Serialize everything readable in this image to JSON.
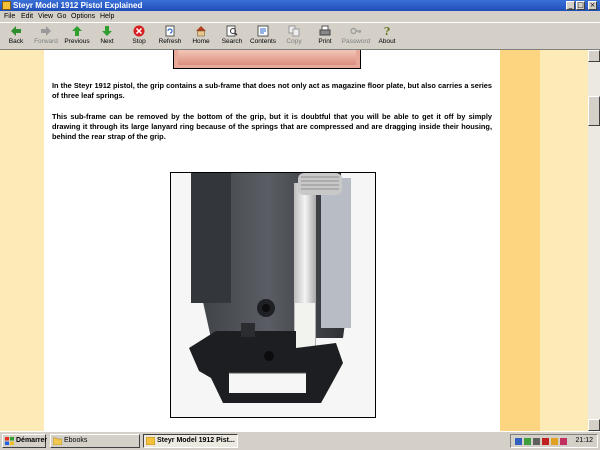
{
  "window": {
    "title": "Steyr Model 1912 Pistol Explained",
    "controls": [
      "_",
      "□",
      "×"
    ]
  },
  "menu": [
    "File",
    "Edit",
    "View",
    "Go",
    "Options",
    "Help"
  ],
  "toolbar": [
    {
      "label": "Back",
      "icon": "back-arrow-icon",
      "enabled": true
    },
    {
      "label": "Forward",
      "icon": "forward-arrow-icon",
      "enabled": false
    },
    {
      "label": "Previous",
      "icon": "previous-arrow-icon",
      "enabled": true
    },
    {
      "label": "Next",
      "icon": "next-arrow-icon",
      "enabled": true
    },
    {
      "label": "Stop",
      "icon": "stop-icon",
      "enabled": true
    },
    {
      "label": "Refresh",
      "icon": "refresh-icon",
      "enabled": true
    },
    {
      "label": "Home",
      "icon": "home-icon",
      "enabled": true
    },
    {
      "label": "Search",
      "icon": "search-icon",
      "enabled": true
    },
    {
      "label": "Contents",
      "icon": "contents-icon",
      "enabled": true
    },
    {
      "label": "Copy",
      "icon": "copy-icon",
      "enabled": false
    },
    {
      "label": "Print",
      "icon": "print-icon",
      "enabled": true
    },
    {
      "label": "Password",
      "icon": "key-icon",
      "enabled": false
    },
    {
      "label": "About",
      "icon": "about-icon",
      "enabled": true
    }
  ],
  "content": {
    "paragraph_1": "In the Steyr 1912 pistol, the grip contains a sub-frame that does not only act as magazine floor plate, but also carries a series of three leaf springs.",
    "paragraph_2": "This sub-frame can be removed by the bottom of the grip, but it is doubtful that you will be able to get it off by simply drawing it through its large lanyard ring because of the springs that are compressed and are dragging inside their housing, behind the rear strap of the grip."
  },
  "taskbar": {
    "start_label": "Démarrer",
    "tasks": [
      {
        "label": "Ebooks",
        "active": false
      },
      {
        "label": "Steyr Model 1912 Pist...",
        "active": true
      }
    ],
    "clock": "21:12"
  },
  "colors": {
    "page_background": "#fcebb6",
    "stripe": "#fdd581",
    "titlebar": "#1f4fb8"
  }
}
